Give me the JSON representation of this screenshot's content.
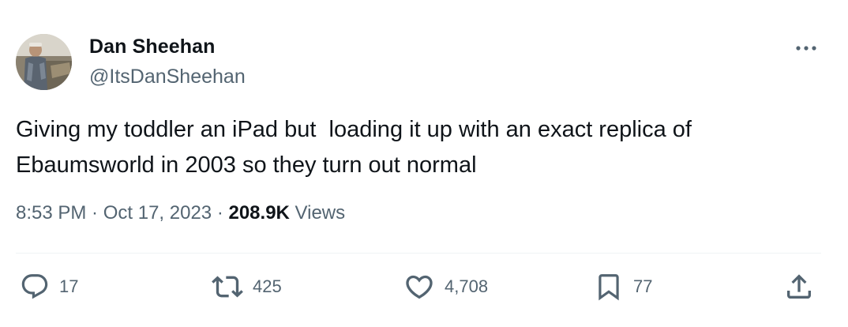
{
  "author": {
    "name": "Dan Sheehan",
    "handle": "@ItsDanSheehan"
  },
  "tweet": {
    "text": "Giving my toddler an iPad but  loading it up with an exact replica of\nEbaumsworld in 2003 so they turn out normal"
  },
  "meta": {
    "time": "8:53 PM",
    "separator1": " · ",
    "date": "Oct 17, 2023",
    "separator2": " · ",
    "views_count": "208.9K",
    "views_label": " Views"
  },
  "actions": {
    "replies": "17",
    "retweets": "425",
    "likes": "4,708",
    "bookmarks": "77"
  },
  "icons": {
    "more": "ellipsis-icon",
    "reply": "reply-icon",
    "retweet": "retweet-icon",
    "like": "heart-icon",
    "bookmark": "bookmark-icon",
    "share": "share-icon"
  },
  "colors": {
    "text_primary": "#0f1419",
    "text_secondary": "#536471",
    "divider": "#eff3f4"
  }
}
